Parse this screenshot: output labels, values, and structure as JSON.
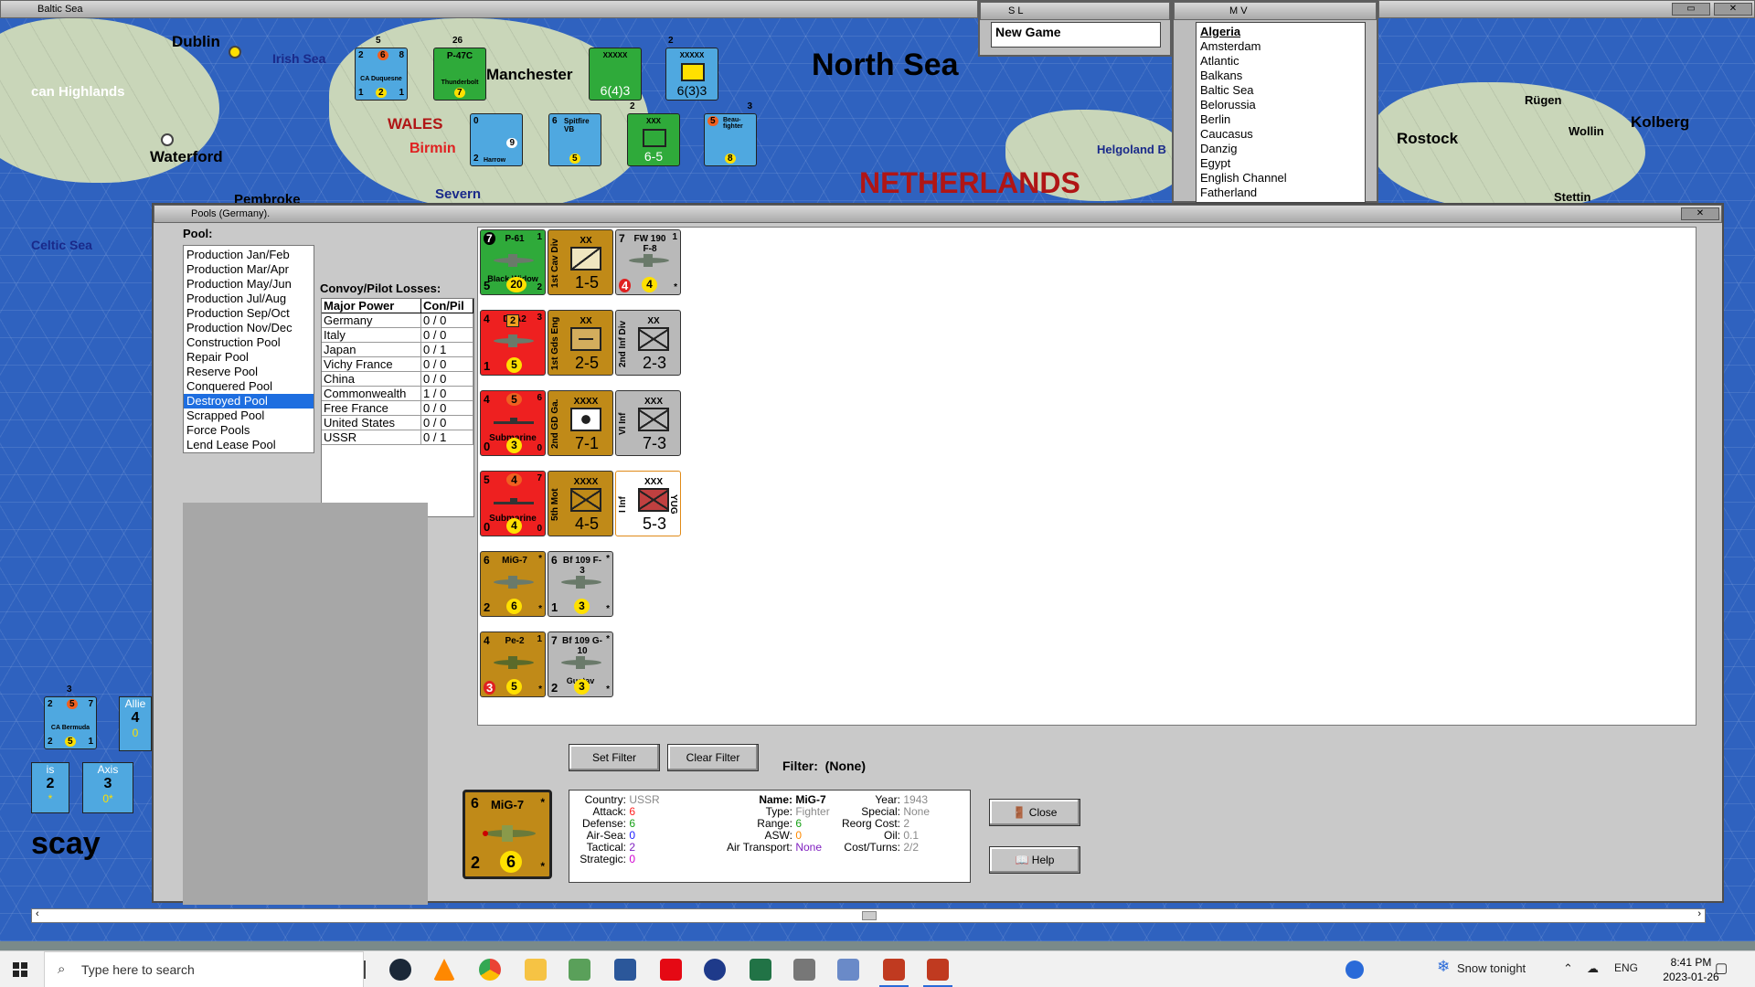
{
  "map": {
    "window_title": "Baltic Sea",
    "labels": {
      "north_sea": "North Sea",
      "netherlands": "NETHERLANDS",
      "dublin": "Dublin",
      "irish_sea": "Irish Sea",
      "highlands": "can Highlands",
      "waterford": "Waterford",
      "wales": "WALES",
      "birmingham": "Birmin",
      "severn": "Severn",
      "pembroke": "Pembroke",
      "manchester": "Manchester",
      "celtic_sea": "Celtic Sea",
      "biscay": "scay",
      "helgoland": "Helgoland B",
      "rostock": "Rostock",
      "kolberg": "Kolberg",
      "rugen": "Rügen",
      "wollin": "Wollin",
      "stettin": "Stettin"
    },
    "counters": {
      "ca_duquesne": {
        "name": "CA Duquesne",
        "tl": "2",
        "tm": "6",
        "tr": "8",
        "bl": "1",
        "bm": "2",
        "br": "1",
        "stack": "5"
      },
      "p47c": {
        "name": "P-47C",
        "sub": "Thunderbolt",
        "bm": "7",
        "stack": "26"
      },
      "spitfire": {
        "name": "Spitfire VB",
        "tl": "6",
        "bm": "5"
      },
      "harrow": {
        "name": "Harrow",
        "tl": "0",
        "bl": "2",
        "br": "9"
      },
      "xxxxx_1": {
        "size": "XXXXX",
        "value": "6(4)3"
      },
      "xxxxx_2": {
        "size": "XXXXX",
        "value": "6(3)3",
        "stack": "2"
      },
      "xxx_65": {
        "size": "XXX",
        "value": "6-5",
        "stack": "2"
      },
      "beaufighter": {
        "name": "Beau-fighter",
        "tl": "5",
        "bm": "8",
        "stack": "3"
      },
      "ca_bermuda": {
        "name": "CA Bermuda",
        "tl": "2",
        "tm": "5",
        "tr": "7",
        "bl": "2",
        "bm": "5",
        "br": "1",
        "stack": "3"
      }
    },
    "side_boxes": {
      "allies_label": "Allie",
      "allies_value": "4",
      "allies_sub": "0",
      "axis_label": "Axis",
      "axis_value": "3",
      "axis_sub": "0*",
      "left_label": "is",
      "left_value": "2",
      "left_sub": "*"
    }
  },
  "sl_panel": {
    "title": "S L",
    "value": "New Game"
  },
  "mv_panel": {
    "title": "M V",
    "items": [
      "Algeria",
      "Amsterdam",
      "Atlantic",
      "Balkans",
      "Baltic Sea",
      "Belorussia",
      "Berlin",
      "Caucasus",
      "Danzig",
      "Egypt",
      "English Channel",
      "Fatherland"
    ],
    "selected": "Algeria"
  },
  "pools": {
    "title": "Pools (Germany).",
    "pool_label": "Pool:",
    "pool_items": [
      "Production Jan/Feb",
      "Production Mar/Apr",
      "Production May/Jun",
      "Production Jul/Aug",
      "Production Sep/Oct",
      "Production Nov/Dec",
      "Construction Pool",
      "Repair Pool",
      "Reserve Pool",
      "Conquered Pool",
      "Destroyed Pool",
      "Scrapped Pool",
      "Force Pools",
      "Lend Lease Pool"
    ],
    "selected_pool": "Destroyed Pool",
    "losses_label": "Convoy/Pilot Losses:",
    "losses_headers": [
      "Major Power",
      "Con/Pil"
    ],
    "losses_rows": [
      [
        "Germany",
        "0 / 0"
      ],
      [
        "Italy",
        "0 / 0"
      ],
      [
        "Japan",
        "0 / 1"
      ],
      [
        "Vichy France",
        "0 / 0"
      ],
      [
        "China",
        "0 / 0"
      ],
      [
        "Commonwealth",
        "1 / 0"
      ],
      [
        "Free France",
        "0 / 0"
      ],
      [
        "United States",
        "0 / 0"
      ],
      [
        "USSR",
        "0 / 1"
      ]
    ],
    "units": [
      {
        "kind": "air",
        "color": "green",
        "name": "P-61",
        "sub": "Black Widow",
        "tl": "7",
        "tr": "1",
        "bl": "5",
        "bm": "20",
        "br": "2"
      },
      {
        "kind": "land",
        "color": "brown",
        "side": "1st Cav Div",
        "size": "XX",
        "value": "1-5",
        "sym": "cav"
      },
      {
        "kind": "air",
        "color": "grey",
        "name": "FW 190 F-8",
        "sub": "",
        "tl": "7",
        "tr": "1",
        "bl": "4",
        "bm": "4",
        "br": "*",
        "blRed": true
      },
      {
        "kind": "air",
        "color": "red",
        "name": "D3A2",
        "sub": "",
        "tl": "4",
        "tr": "3",
        "bl": "1",
        "bm": "5",
        "br": "",
        "badge": "2"
      },
      {
        "kind": "land",
        "color": "brown",
        "side": "1st Gds Eng",
        "size": "XX",
        "value": "2-5",
        "sym": "eng"
      },
      {
        "kind": "land",
        "color": "grey",
        "side": "2nd Inf Div",
        "size": "XX",
        "value": "2-3",
        "sym": "inf"
      },
      {
        "kind": "sub",
        "color": "red",
        "name": "Submarine",
        "tl": "4",
        "tm": "5",
        "tr": "6",
        "bl": "0",
        "bm": "3",
        "br": "0"
      },
      {
        "kind": "land",
        "color": "brown",
        "side": "2nd GD Ga.",
        "size": "XXXX",
        "value": "7-1",
        "sym": "art"
      },
      {
        "kind": "land",
        "color": "grey",
        "side": "VI Inf",
        "size": "XXX",
        "value": "7-3",
        "sym": "inf"
      },
      {
        "kind": "sub",
        "color": "red",
        "name": "Submarine",
        "tl": "5",
        "tm": "4",
        "tr": "7",
        "bl": "0",
        "bm": "4",
        "br": "0"
      },
      {
        "kind": "land",
        "color": "brown",
        "side": "5th Mot",
        "size": "XXXX",
        "value": "4-5",
        "sym": "mot"
      },
      {
        "kind": "land",
        "color": "white",
        "side": "I Inf",
        "size": "XXX",
        "value": "5-3",
        "sym": "inf",
        "right": "YUG"
      },
      {
        "kind": "air",
        "color": "brown",
        "name": "MiG-7",
        "sub": "",
        "tl": "6",
        "tr": "*",
        "bl": "2",
        "bm": "6",
        "br": "*"
      },
      {
        "kind": "air",
        "color": "grey",
        "name": "Bf 109 F-3",
        "sub": "",
        "tl": "6",
        "tr": "*",
        "bl": "1",
        "bm": "3",
        "br": "*"
      },
      {
        "kind": "air",
        "color": "brown",
        "name": "Pe-2",
        "sub": "",
        "tl": "4",
        "tr": "1",
        "bl": "3",
        "bm": "5",
        "br": "*",
        "blRed": true,
        "camo": true
      },
      {
        "kind": "air",
        "color": "grey",
        "name": "Bf 109 G-10",
        "sub": "Gustav",
        "tl": "7",
        "tr": "*",
        "bl": "2",
        "bm": "3",
        "br": "*"
      }
    ],
    "set_filter": "Set Filter",
    "clear_filter": "Clear Filter",
    "filter_label": "Filter:",
    "filter_value": "(None)",
    "selected_unit": {
      "name": "MiG-7",
      "tl": "6",
      "tr": "*",
      "bl": "2",
      "bm": "6",
      "br": "*"
    },
    "details": {
      "country_k": "Country:",
      "country_v": "USSR",
      "attack_k": "Attack:",
      "attack_v": "6",
      "defense_k": "Defense:",
      "defense_v": "6",
      "airsea_k": "Air-Sea:",
      "airsea_v": "0",
      "tactical_k": "Tactical:",
      "tactical_v": "2",
      "strategic_k": "Strategic:",
      "strategic_v": "0",
      "name_k": "Name:",
      "name_v": "MiG-7",
      "type_k": "Type:",
      "type_v": "Fighter",
      "range_k": "Range:",
      "range_v": "6",
      "asw_k": "ASW:",
      "asw_v": "0",
      "airtrans_k": "Air Transport:",
      "airtrans_v": "None",
      "year_k": "Year:",
      "year_v": "1943",
      "special_k": "Special:",
      "special_v": "None",
      "reorg_k": "Reorg Cost:",
      "reorg_v": "2",
      "oil_k": "Oil:",
      "oil_v": "0.1",
      "cost_k": "Cost/Turns:",
      "cost_v": "2/2"
    },
    "close_label": "Close",
    "help_label": "Help"
  },
  "taskbar": {
    "search_placeholder": "Type here to search",
    "weather": "Snow tonight",
    "lang": "ENG",
    "time": "8:41 PM",
    "date": "2023-01-26"
  },
  "colors": {
    "sea": "#2f62bf",
    "land": "#c9d6b9",
    "green": "#2faa3a",
    "red": "#ee2020",
    "brown": "#c08a18",
    "grey": "#b9b9b9",
    "blue": "#4fa8e0",
    "selection": "#1e6ee0"
  }
}
